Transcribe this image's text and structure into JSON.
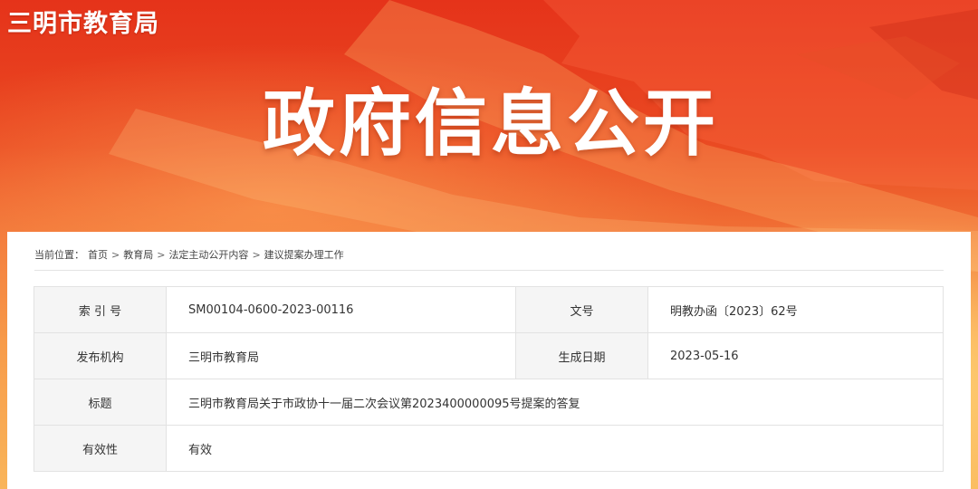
{
  "header": {
    "site_name": "三明市教育局",
    "banner_title": "政府信息公开"
  },
  "breadcrumb": {
    "prefix": "当前位置：",
    "items": [
      "首页",
      "教育局",
      "法定主动公开内容",
      "建议提案办理工作"
    ],
    "separator": ">"
  },
  "meta_table": {
    "index_no_label": "索 引 号",
    "index_no_value": "SM00104-0600-2023-00116",
    "doc_no_label": "文号",
    "doc_no_value": "明教办函〔2023〕62号",
    "publisher_label": "发布机构",
    "publisher_value": "三明市教育局",
    "date_label": "生成日期",
    "date_value": "2023-05-16",
    "title_label": "标题",
    "title_value": "三明市教育局关于市政协十一届二次会议第2023400000095号提案的答复",
    "validity_label": "有效性",
    "validity_value": "有效"
  },
  "colors": {
    "banner_red": "#e5331a",
    "banner_orange": "#f79b4a",
    "label_bg": "#f5f5f5",
    "border": "#e2e2e2"
  }
}
